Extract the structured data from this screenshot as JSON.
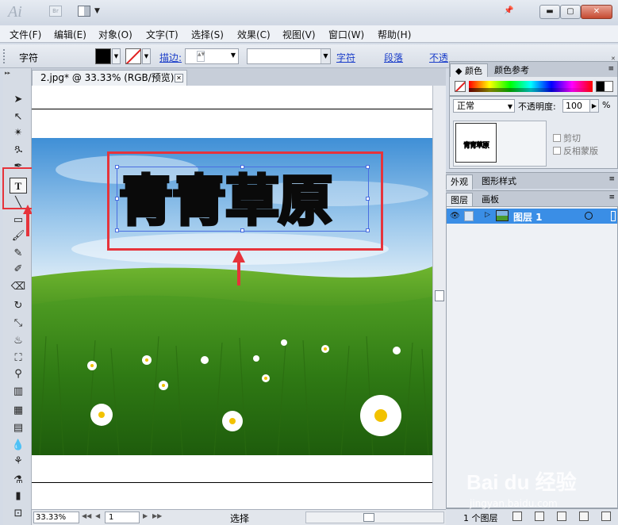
{
  "app": {
    "logo": "Ai",
    "bridge": "Br"
  },
  "menu": [
    "文件(F)",
    "编辑(E)",
    "对象(O)",
    "文字(T)",
    "选择(S)",
    "效果(C)",
    "视图(V)",
    "窗口(W)",
    "帮助(H)"
  ],
  "control_bar": {
    "label": "字符",
    "stroke_label": "描边:",
    "char_link": "字符",
    "para_link": "段落",
    "opacity_link": "不透"
  },
  "document": {
    "tab_title": "2.jpg* @ 33.33% (RGB/预览)",
    "title_text": "青青草原"
  },
  "status": {
    "zoom": "33.33%",
    "page": "1",
    "tool_label": "选择"
  },
  "color_panel": {
    "tabs": [
      "颜色",
      "颜色参考"
    ]
  },
  "transparency": {
    "blend_mode": "正常",
    "opacity_label": "不透明度:",
    "opacity_value": "100",
    "opacity_unit": "%",
    "thumb_text": "青青草原",
    "clip_label": "剪切",
    "invert_label": "反相蒙版"
  },
  "appearance_tabs": [
    "外观",
    "图形样式"
  ],
  "layers_tabs": [
    "图层",
    "画板"
  ],
  "layers": {
    "items": [
      {
        "name": "图层 1"
      }
    ],
    "count_label": "1 个图层"
  },
  "watermark": {
    "main": "Bai du 经验",
    "sub": "jingyan.baidu.com"
  },
  "colors": {
    "highlight": "#e6333b",
    "selection": "#3a8ee6",
    "link": "#1a3dc9"
  }
}
